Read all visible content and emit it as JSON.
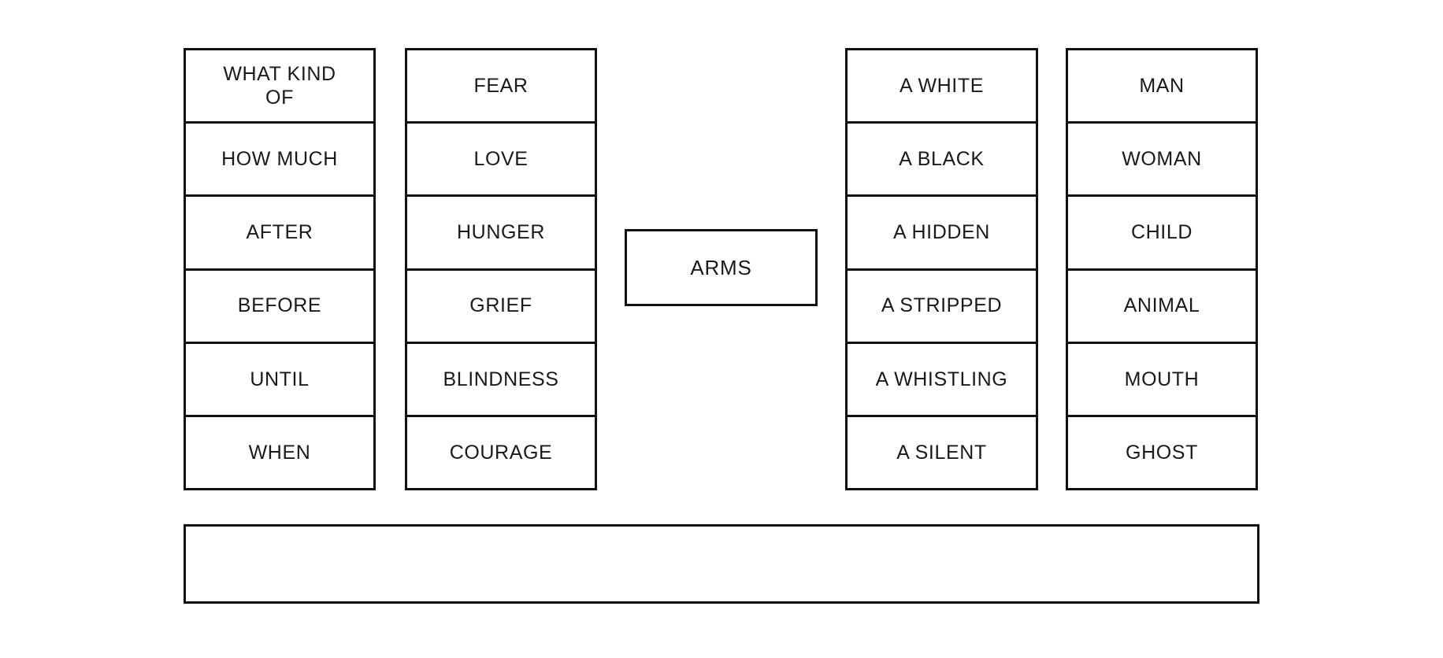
{
  "page": {
    "background_color": "#ffffff",
    "border_color": "#111111",
    "text_color": "#1a1a1a"
  },
  "columns": [
    {
      "id": "column-1",
      "name": "question-stem-column",
      "cells": [
        {
          "label": "WHAT KIND\nOF"
        },
        {
          "label": "HOW MUCH"
        },
        {
          "label": "AFTER"
        },
        {
          "label": "BEFORE"
        },
        {
          "label": "UNTIL"
        },
        {
          "label": "WHEN"
        }
      ]
    },
    {
      "id": "column-2",
      "name": "abstract-noun-column",
      "cells": [
        {
          "label": "FEAR"
        },
        {
          "label": "LOVE"
        },
        {
          "label": "HUNGER"
        },
        {
          "label": "GRIEF"
        },
        {
          "label": "BLINDNESS"
        },
        {
          "label": "COURAGE"
        }
      ]
    },
    {
      "id": "column-3",
      "name": "adjective-column",
      "cells": [
        {
          "label": "A WHITE"
        },
        {
          "label": "A BLACK"
        },
        {
          "label": "A HIDDEN"
        },
        {
          "label": "A STRIPPED"
        },
        {
          "label": "A WHISTLING"
        },
        {
          "label": "A SILENT"
        }
      ]
    },
    {
      "id": "column-4",
      "name": "subject-noun-column",
      "cells": [
        {
          "label": "MAN"
        },
        {
          "label": "WOMAN"
        },
        {
          "label": "CHILD"
        },
        {
          "label": "ANIMAL"
        },
        {
          "label": "MOUTH"
        },
        {
          "label": "GHOST"
        }
      ]
    }
  ],
  "center": {
    "label": "ARMS"
  },
  "answer": {
    "value": "",
    "placeholder": ""
  }
}
